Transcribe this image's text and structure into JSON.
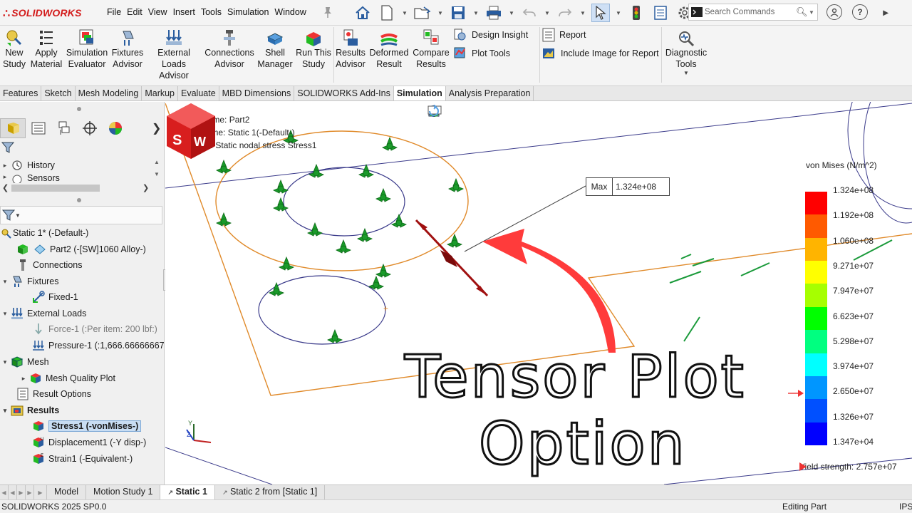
{
  "app": {
    "logo_text": "SOLIDWORKS",
    "menus": [
      "File",
      "Edit",
      "View",
      "Insert",
      "Tools",
      "Simulation",
      "Window"
    ],
    "search_placeholder": "Search Commands"
  },
  "ribbon": {
    "buttons": [
      {
        "name": "new-study-button",
        "label": "New Study",
        "icon": "new-study-icon"
      },
      {
        "name": "apply-material-button",
        "label": "Apply Material",
        "icon": "apply-material-icon"
      },
      {
        "name": "simulation-evaluator-button",
        "label": "Simulation Evaluator",
        "icon": "simulation-evaluator-icon"
      },
      {
        "name": "fixtures-advisor-button",
        "label": "Fixtures Advisor",
        "icon": "fixtures-advisor-icon"
      },
      {
        "name": "external-loads-advisor-button",
        "label": "External Loads Advisor",
        "icon": "external-loads-icon"
      },
      {
        "name": "connections-advisor-button",
        "label": "Connections Advisor",
        "icon": "connections-icon"
      },
      {
        "name": "shell-manager-button",
        "label": "Shell Manager",
        "icon": "shell-manager-icon"
      },
      {
        "name": "run-this-study-button",
        "label": "Run This Study",
        "icon": "run-study-icon"
      },
      {
        "name": "results-advisor-button",
        "label": "Results Advisor",
        "icon": "results-advisor-icon"
      },
      {
        "name": "deformed-result-button",
        "label": "Deformed Result",
        "icon": "deformed-result-icon"
      },
      {
        "name": "compare-results-button",
        "label": "Compare Results",
        "icon": "compare-results-icon"
      },
      {
        "name": "diagnostic-tools-button",
        "label": "Diagnostic Tools",
        "icon": "diagnostic-tools-icon"
      }
    ],
    "design_insight": "Design Insight",
    "plot_tools": "Plot Tools",
    "report": "Report",
    "include_image": "Include Image for Report"
  },
  "tabs": [
    "Features",
    "Sketch",
    "Mesh Modeling",
    "Markup",
    "Evaluate",
    "MBD Dimensions",
    "SOLIDWORKS Add-Ins",
    "Simulation",
    "Analysis Preparation"
  ],
  "active_tab": "Simulation",
  "tree": {
    "history": "History",
    "sensors": "Sensors",
    "study": "Static 1* (-Default-)",
    "part": "Part2 (-[SW]1060 Alloy-)",
    "connections": "Connections",
    "fixtures": "Fixtures",
    "fixed": "Fixed-1",
    "external_loads": "External Loads",
    "force": "Force-1 (:Per item: 200 lbf:)",
    "pressure": "Pressure-1 (:1,666.66666667",
    "mesh": "Mesh",
    "mesh_quality": "Mesh Quality Plot",
    "result_options": "Result Options",
    "results": "Results",
    "stress": "Stress1 (-vonMises-)",
    "displacement": "Displacement1 (-Y disp-)",
    "strain": "Strain1 (-Equivalent-)"
  },
  "viewport": {
    "model_name": "Model name: Part2",
    "study_name": "Study name: Static 1(-Default-)",
    "plot_type": "Plot type: Static nodal stress Stress1",
    "max_key": "Max",
    "max_value": "1.324e+08",
    "overlay_line1": "Tensor Plot",
    "overlay_line2": "Option"
  },
  "legend": {
    "title": "von Mises (N/m^2)",
    "labels": [
      "1.324e+08",
      "1.192e+08",
      "1.060e+08",
      "9.271e+07",
      "7.947e+07",
      "6.623e+07",
      "5.298e+07",
      "3.974e+07",
      "2.650e+07",
      "1.326e+07",
      "1.347e+04"
    ],
    "colors": [
      "#ff0000",
      "#ff5a00",
      "#ffb400",
      "#ffff00",
      "#a6ff00",
      "#00ff00",
      "#00ff80",
      "#00ffff",
      "#0096ff",
      "#0050ff",
      "#0000ff"
    ],
    "yield_text": "Yield strength: 2.757e+07",
    "yield_arrow_value": "2.650e+07"
  },
  "bottom_tabs": [
    "Model",
    "Motion Study 1",
    "Static 1",
    "Static 2 from [Static 1]"
  ],
  "active_bottom_tab": "Static 1",
  "status": {
    "version": "SOLIDWORKS 2025 SP0.0",
    "mode": "Editing Part",
    "units": "IPS"
  }
}
